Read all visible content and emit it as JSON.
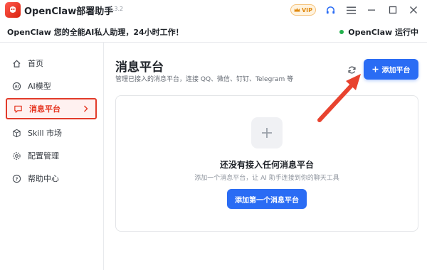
{
  "window": {
    "title": "OpenClaw部署助手",
    "version": "v1.3.2",
    "vip_label": "VIP",
    "icons": [
      "app-logo-icon",
      "crown-icon",
      "headset-icon",
      "menu-icon",
      "minimize-icon",
      "maximize-icon",
      "close-icon"
    ]
  },
  "subheader": {
    "tagline": "OpenClaw 您的全能AI私人助理，24小时工作！",
    "status_text": "OpenClaw 运行中",
    "status_color": "#22b14c"
  },
  "sidebar": {
    "items": [
      {
        "label": "首页",
        "icon": "home-icon"
      },
      {
        "label": "AI模型",
        "icon": "ai-icon"
      },
      {
        "label": "消息平台",
        "icon": "message-icon",
        "active": true
      },
      {
        "label": "Skill 市场",
        "icon": "cube-icon"
      },
      {
        "label": "配置管理",
        "icon": "gear-icon"
      },
      {
        "label": "帮助中心",
        "icon": "help-icon"
      }
    ]
  },
  "main": {
    "title": "消息平台",
    "description": "管理已接入的消息平台，连接 QQ、微信、钉钉、Telegram 等",
    "add_button": "添加平台",
    "empty": {
      "title": "还没有接入任何消息平台",
      "description": "添加一个消息平台，让 AI 助手连接到你的聊天工具",
      "button": "添加第一个消息平台"
    }
  },
  "colors": {
    "accent": "#2a6cf4",
    "active_red": "#e5341f",
    "annotation": "#e8432f"
  }
}
